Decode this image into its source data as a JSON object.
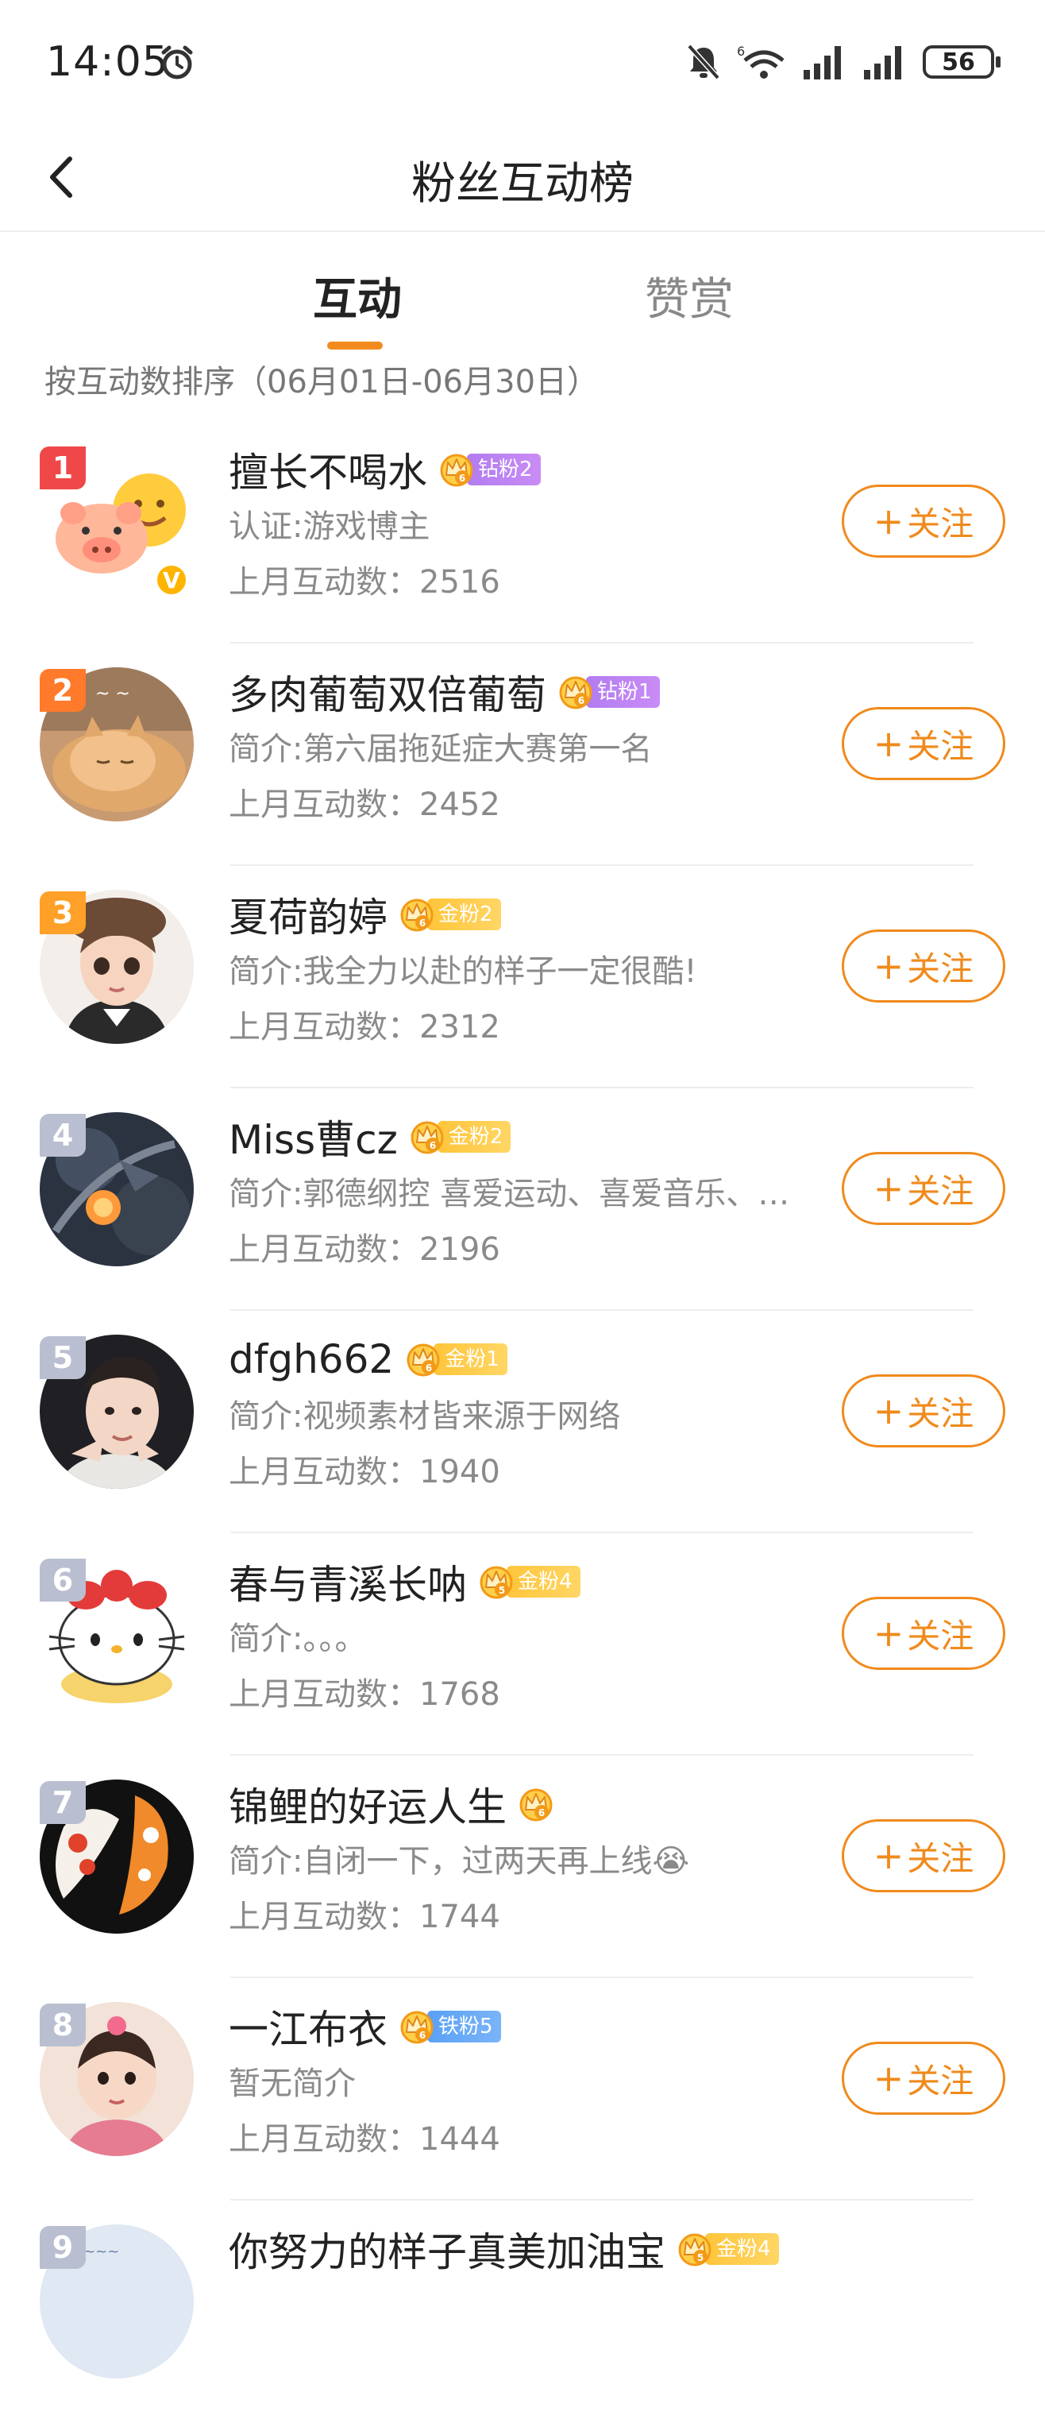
{
  "status_bar": {
    "time": "14:05",
    "battery": "56"
  },
  "header": {
    "title": "粉丝互动榜"
  },
  "tabs": [
    {
      "label": "互动",
      "active": true
    },
    {
      "label": "赞赏",
      "active": false
    }
  ],
  "sort_hint": "按互动数排序（06月01日-06月30日）",
  "follow_label": "关注",
  "rank_colors": {
    "1": "#f04848",
    "2": "#ff7a2a",
    "3": "#ffa128",
    "default": "#b9bfd0"
  },
  "fans": [
    {
      "rank": "1",
      "name": "擅长不喝水",
      "badge": "钻粉2",
      "badge_type": "diamond",
      "bio": "认证:游戏博主",
      "count": "上月互动数：2516",
      "verified": true
    },
    {
      "rank": "2",
      "name": "多肉葡萄双倍葡萄",
      "badge": "钻粉1",
      "badge_type": "diamond",
      "bio": "简介:第六届拖延症大赛第一名",
      "count": "上月互动数：2452",
      "verified": false
    },
    {
      "rank": "3",
      "name": "夏荷韵婷",
      "badge": "金粉2",
      "badge_type": "gold",
      "bio": "简介:我全力以赴的样子一定很酷!",
      "count": "上月互动数：2312",
      "verified": false
    },
    {
      "rank": "4",
      "name": "Miss曹cz",
      "badge": "金粉2",
      "badge_type": "gold",
      "bio": "简介:郭德纲控 喜爱运动、喜爱音乐、…",
      "count": "上月互动数：2196",
      "verified": false
    },
    {
      "rank": "5",
      "name": "dfgh662",
      "badge": "金粉1",
      "badge_type": "gold",
      "bio": "简介:视频素材皆来源于网络",
      "count": "上月互动数：1940",
      "verified": false
    },
    {
      "rank": "6",
      "name": "春与青溪长呐",
      "badge": "金粉4",
      "badge_type": "gold",
      "bio": "简介:。。。",
      "count": "上月互动数：1768",
      "verified": false
    },
    {
      "rank": "7",
      "name": "锦鲤的好运人生",
      "badge": "",
      "badge_type": "crown-only",
      "bio": "简介:自闭一下，过两天再上线😭",
      "count": "上月互动数：1744",
      "verified": false
    },
    {
      "rank": "8",
      "name": "一江布衣",
      "badge": "铁粉5",
      "badge_type": "iron",
      "bio": "暂无简介",
      "count": "上月互动数：1444",
      "verified": false
    },
    {
      "rank": "9",
      "name": "你努力的样子真美加油宝",
      "badge": "金粉4",
      "badge_type": "gold",
      "bio": "",
      "count": "",
      "verified": false
    }
  ],
  "icons": {
    "back": "chevron-left-icon",
    "alarm": "alarm-clock-icon",
    "mute": "bell-off-icon",
    "wifi": "wifi-icon",
    "signal": "signal-bars-icon",
    "battery": "battery-icon",
    "crown": "crown-icon",
    "verified": "verified-v-icon",
    "plus": "plus-icon"
  }
}
